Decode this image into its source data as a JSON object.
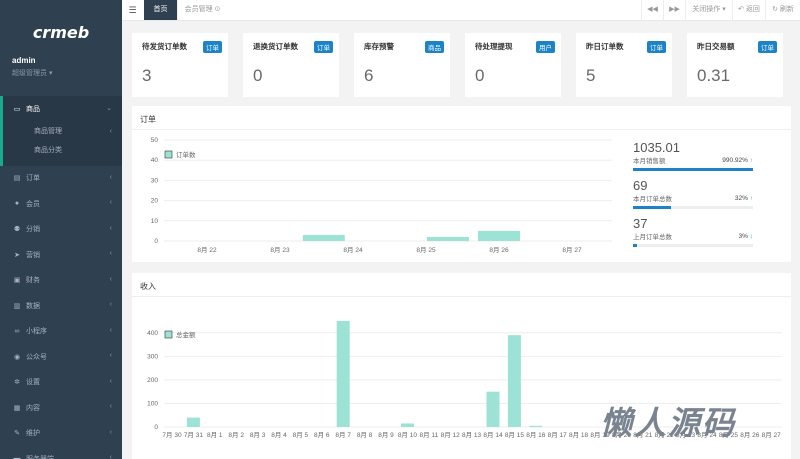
{
  "brand": {
    "logo_text": "crmeb"
  },
  "profile": {
    "name": "admin",
    "role": "超级管理员 ▾"
  },
  "nav": {
    "items": [
      {
        "label": "商品",
        "icon": "monitor-icon"
      },
      {
        "label": "订单",
        "icon": "file-icon"
      },
      {
        "label": "会员",
        "icon": "user-icon"
      },
      {
        "label": "分销",
        "icon": "users-icon"
      },
      {
        "label": "营销",
        "icon": "send-icon"
      },
      {
        "label": "财务",
        "icon": "money-icon"
      },
      {
        "label": "数据",
        "icon": "chart-icon"
      },
      {
        "label": "小程序",
        "icon": "link-icon"
      },
      {
        "label": "公众号",
        "icon": "chat-icon"
      },
      {
        "label": "设置",
        "icon": "gear-icon"
      },
      {
        "label": "内容",
        "icon": "box-icon"
      },
      {
        "label": "维护",
        "icon": "wrench-icon"
      },
      {
        "label": "服务器端",
        "icon": "server-icon"
      }
    ],
    "sub": [
      "商品管理",
      "商品分类"
    ]
  },
  "topbar": {
    "menu_icon": "☰",
    "tabs": [
      "首页",
      "会员管理 ⊙"
    ],
    "prev": "◀◀",
    "next": "▶▶",
    "close_ops": "关闭操作 ▾",
    "back": "↶ 返回",
    "refresh": "↻ 刷新"
  },
  "stats": [
    {
      "title": "待发货订单数",
      "badge": "订单",
      "value": "3"
    },
    {
      "title": "退换货订单数",
      "badge": "订单",
      "value": "0"
    },
    {
      "title": "库存预警",
      "badge": "商品",
      "value": "6"
    },
    {
      "title": "待处理提现",
      "badge": "用户",
      "value": "0"
    },
    {
      "title": "昨日订单数",
      "badge": "订单",
      "value": "5"
    },
    {
      "title": "昨日交易额",
      "badge": "订单",
      "value": "0.31"
    }
  ],
  "orders_panel": {
    "title": "订单",
    "right_stats": [
      {
        "big": "1035.01",
        "label": "本月销售额",
        "pct": "990.92%",
        "arrow": "↑",
        "fill": 1.0
      },
      {
        "big": "69",
        "label": "本月订单总数",
        "pct": "32%",
        "arrow": "↑",
        "fill": 0.32
      },
      {
        "big": "37",
        "label": "上月订单总数",
        "pct": "3%",
        "arrow": "↓",
        "fill": 0.03
      }
    ]
  },
  "income_panel": {
    "title": "收入"
  },
  "chart_data": [
    {
      "type": "bar",
      "legend": "订单数",
      "categories": [
        "8月 22",
        "8月 23",
        "8月 24",
        "8月 25",
        "8月 26",
        "8月 27"
      ],
      "x": [
        0,
        1,
        1.6,
        2.5,
        3.3,
        4
      ],
      "values": [
        0,
        0,
        3,
        0,
        2,
        5
      ],
      "ylim": [
        0,
        50
      ],
      "yticks": [
        0,
        10,
        20,
        30,
        40,
        50
      ],
      "color": "#9de3d5",
      "grid": true
    },
    {
      "type": "bar",
      "legend": "总金额",
      "categories": [
        "7月 30",
        "7月 31",
        "8月 1",
        "8月 2",
        "8月 3",
        "8月 4",
        "8月 5",
        "8月 6",
        "8月 7",
        "8月 8",
        "8月 9",
        "8月 10",
        "8月 11",
        "8月 12",
        "8月 13",
        "8月 14",
        "8月 15",
        "8月 16",
        "8月 17",
        "8月 18",
        "8月 19",
        "8月 20",
        "8月 21",
        "8月 22",
        "8月 23",
        "8月 24",
        "8月 25",
        "8月 26",
        "8月 27"
      ],
      "values": [
        0,
        40,
        0,
        0,
        0,
        0,
        0,
        0,
        450,
        0,
        0,
        15,
        0,
        0,
        0,
        150,
        390,
        5,
        0,
        0,
        0,
        0,
        0,
        0,
        0,
        0,
        0,
        0,
        0
      ],
      "ylim": [
        0,
        450
      ],
      "yticks": [
        0,
        100,
        200,
        300,
        400
      ],
      "color": "#9de3d5",
      "grid": true
    }
  ],
  "watermark": "懒人源码"
}
